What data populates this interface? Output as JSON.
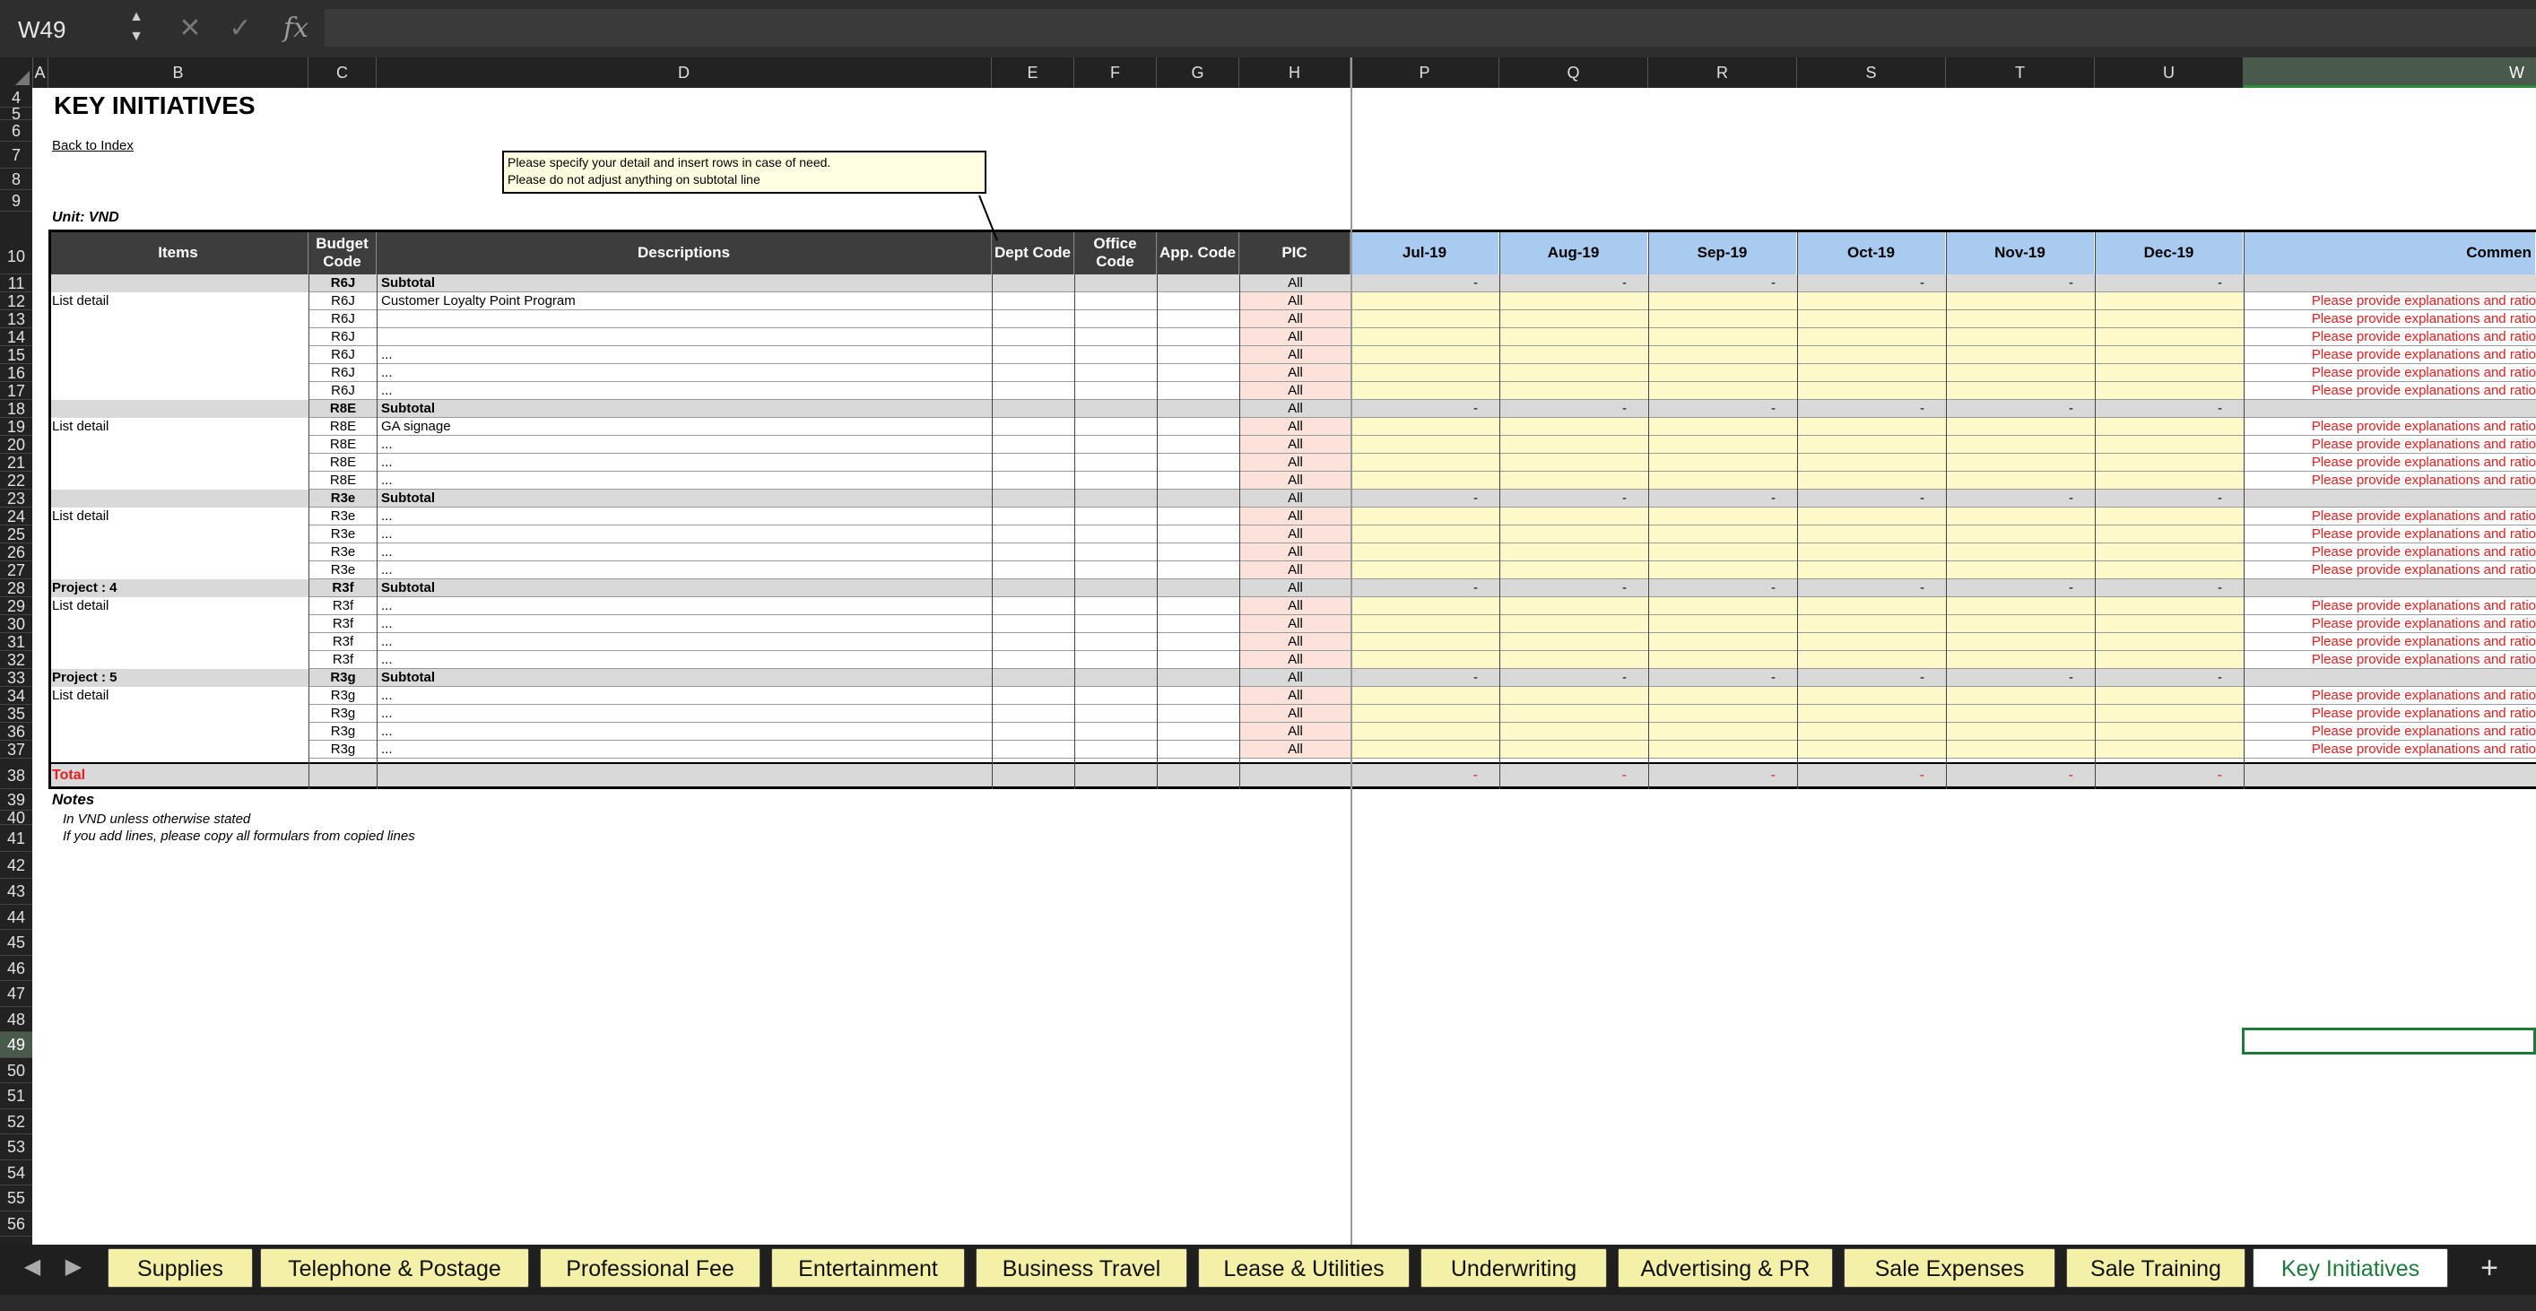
{
  "name_box": "W49",
  "formula": "",
  "columns": [
    "A",
    "B",
    "C",
    "D",
    "E",
    "F",
    "G",
    "H",
    "P",
    "Q",
    "R",
    "S",
    "T",
    "U",
    "W"
  ],
  "rows": [
    "4",
    "5",
    "6",
    "7",
    "8",
    "9",
    "10",
    "11",
    "12",
    "13",
    "14",
    "15",
    "16",
    "17",
    "18",
    "19",
    "20",
    "21",
    "22",
    "23",
    "24",
    "25",
    "26",
    "27",
    "28",
    "29",
    "30",
    "31",
    "32",
    "33",
    "34",
    "35",
    "36",
    "37",
    "38",
    "39",
    "40",
    "41",
    "42",
    "43",
    "44",
    "45",
    "46",
    "47",
    "48",
    "49",
    "50",
    "51",
    "52",
    "53",
    "54",
    "55",
    "56"
  ],
  "sheet": {
    "title": "KEY INITIATIVES",
    "back_link": "Back to Index",
    "unit": "Unit: VND",
    "comment_lines": [
      "Please specify your detail and insert rows in case of need.",
      "Please do not adjust anything on subtotal line"
    ],
    "headers": {
      "items": "Items",
      "budget_code": "Budget Code",
      "descriptions": "Descriptions",
      "dept_code": "Dept Code",
      "office_code": "Office Code",
      "app_code": "App. Code",
      "pic": "PIC",
      "months": [
        "Jul-19",
        "Aug-19",
        "Sep-19",
        "Oct-19",
        "Nov-19",
        "Dec-19"
      ],
      "comment": "Commen"
    },
    "table_rows": [
      {
        "r": "11",
        "item": "",
        "code": "R6J",
        "desc": "Subtotal",
        "pic": "All",
        "subtotal": true
      },
      {
        "r": "12",
        "item": "List detail",
        "code": "R6J",
        "desc": "Customer Loyalty Point Program",
        "pic": "All"
      },
      {
        "r": "13",
        "item": "",
        "code": "R6J",
        "desc": "",
        "pic": "All"
      },
      {
        "r": "14",
        "item": "",
        "code": "R6J",
        "desc": "",
        "pic": "All"
      },
      {
        "r": "15",
        "item": "",
        "code": "R6J",
        "desc": "...",
        "pic": "All"
      },
      {
        "r": "16",
        "item": "",
        "code": "R6J",
        "desc": "...",
        "pic": "All"
      },
      {
        "r": "17",
        "item": "",
        "code": "R6J",
        "desc": "...",
        "pic": "All"
      },
      {
        "r": "18",
        "item": "",
        "code": "R8E",
        "desc": "Subtotal",
        "pic": "All",
        "subtotal": true
      },
      {
        "r": "19",
        "item": "List detail",
        "code": "R8E",
        "desc": "GA signage",
        "pic": "All"
      },
      {
        "r": "20",
        "item": "",
        "code": "R8E",
        "desc": "...",
        "pic": "All"
      },
      {
        "r": "21",
        "item": "",
        "code": "R8E",
        "desc": "...",
        "pic": "All"
      },
      {
        "r": "22",
        "item": "",
        "code": "R8E",
        "desc": "...",
        "pic": "All"
      },
      {
        "r": "23",
        "item": "",
        "code": "R3e",
        "desc": "Subtotal",
        "pic": "All",
        "subtotal": true
      },
      {
        "r": "24",
        "item": "List detail",
        "code": "R3e",
        "desc": "...",
        "pic": "All"
      },
      {
        "r": "25",
        "item": "",
        "code": "R3e",
        "desc": "...",
        "pic": "All"
      },
      {
        "r": "26",
        "item": "",
        "code": "R3e",
        "desc": "...",
        "pic": "All"
      },
      {
        "r": "27",
        "item": "",
        "code": "R3e",
        "desc": "...",
        "pic": "All"
      },
      {
        "r": "28",
        "item": "Project : 4",
        "code": "R3f",
        "desc": "Subtotal",
        "pic": "All",
        "subtotal": true
      },
      {
        "r": "29",
        "item": "List detail",
        "code": "R3f",
        "desc": "...",
        "pic": "All"
      },
      {
        "r": "30",
        "item": "",
        "code": "R3f",
        "desc": "...",
        "pic": "All"
      },
      {
        "r": "31",
        "item": "",
        "code": "R3f",
        "desc": "...",
        "pic": "All"
      },
      {
        "r": "32",
        "item": "",
        "code": "R3f",
        "desc": "...",
        "pic": "All"
      },
      {
        "r": "33",
        "item": "Project : 5",
        "code": "R3g",
        "desc": "Subtotal",
        "pic": "All",
        "subtotal": true
      },
      {
        "r": "34",
        "item": "List detail",
        "code": "R3g",
        "desc": "...",
        "pic": "All"
      },
      {
        "r": "35",
        "item": "",
        "code": "R3g",
        "desc": "...",
        "pic": "All"
      },
      {
        "r": "36",
        "item": "",
        "code": "R3g",
        "desc": "...",
        "pic": "All"
      },
      {
        "r": "37",
        "item": "",
        "code": "R3g",
        "desc": "...",
        "pic": "All"
      }
    ],
    "dash": "-",
    "comment_text": "Please provide explanations and ratio",
    "total_label": "Total",
    "notes_title": "Notes",
    "notes": [
      "In VND unless otherwise stated",
      "If you add lines, please copy all formulars from copied lines"
    ]
  },
  "tabs": [
    "Supplies",
    "Telephone & Postage",
    "Professional Fee",
    "Entertainment",
    "Business Travel",
    "Lease & Utilities",
    "Underwriting",
    "Advertising & PR",
    "Sale Expenses",
    "Sale Training",
    "Key Initiatives"
  ],
  "active_tab": "Key Initiatives",
  "add_sheet": "+",
  "colors": {
    "header_dark": "#3d3d3d",
    "month_blue": "#a9cbf0",
    "input_yellow": "#fdf9c9",
    "pic_pink": "#fbe3dc",
    "subtotal_grey": "#d9d9d9",
    "warning_red": "#e02020",
    "tab_yellow": "#f5f0a8",
    "active_green": "#1e7a3a"
  }
}
